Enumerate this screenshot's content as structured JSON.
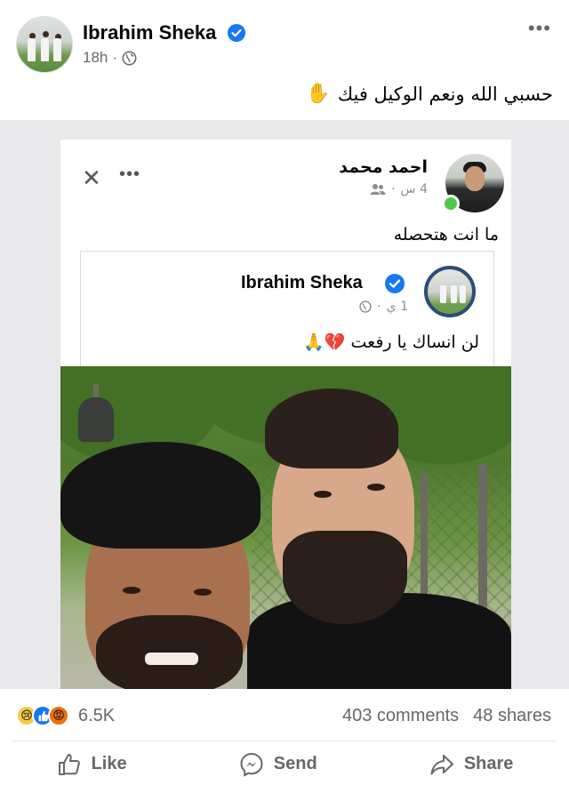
{
  "post": {
    "author": "Ibrahim Sheka",
    "time": "18h",
    "separator": "·",
    "text": "حسبي الله ونعم الوكيل فيك",
    "emoji": "✋"
  },
  "shared_screenshot": {
    "inner_author": "احمد محمد",
    "inner_time": "4 س",
    "inner_separator": "·",
    "inner_text": "ما انت هتحصله",
    "card": {
      "author": "Ibrahim Sheka",
      "time": "1 ي",
      "separator": "·",
      "text": "لن انساك يا رفعت",
      "emojis": "💔🙏"
    }
  },
  "footer": {
    "reaction_count": "6.5K",
    "comments": "403 comments",
    "shares": "48 shares",
    "actions": {
      "like": "Like",
      "send": "Send",
      "share": "Share"
    }
  },
  "icons": {
    "verified": "verified-badge-icon",
    "globe": "globe-icon",
    "more": "more-options-icon",
    "like": "thumbs-up-icon",
    "send": "messenger-icon",
    "share": "share-arrow-icon"
  },
  "colors": {
    "brand_blue": "#1877f2",
    "secondary_text": "#65676b"
  }
}
